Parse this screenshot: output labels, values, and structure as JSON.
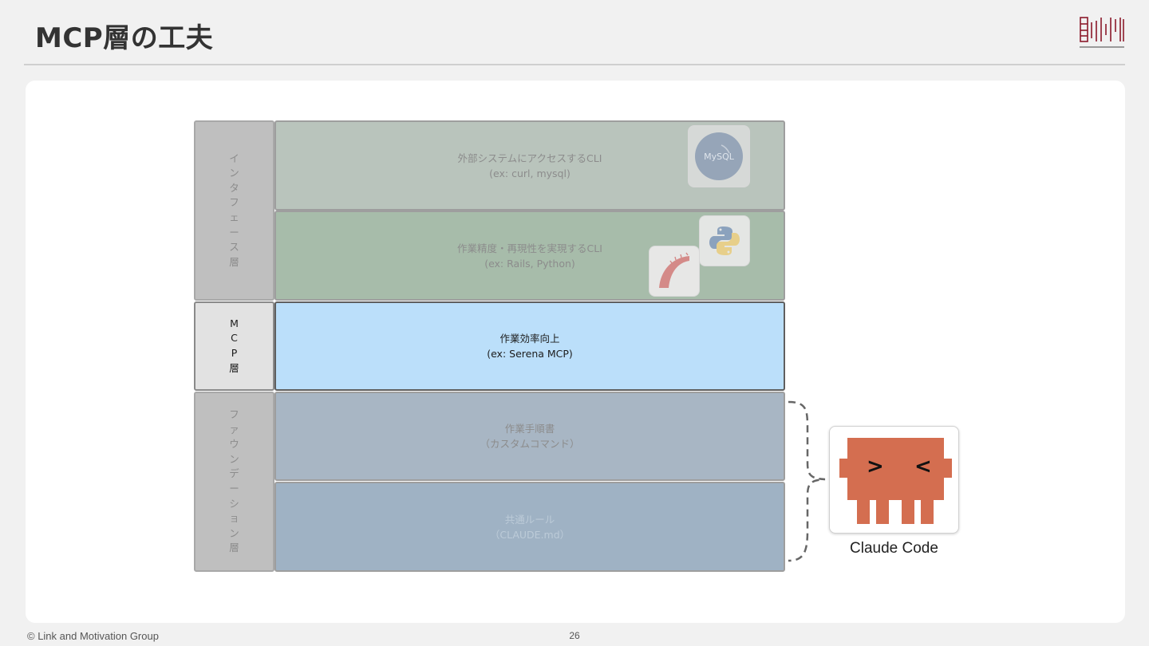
{
  "slide": {
    "title": "MCP層の工夫",
    "footer_copyright": "© Link and Motivation Group",
    "page_number": "26"
  },
  "layers": [
    {
      "side_label": [
        "イ",
        "ン",
        "タ",
        "フ",
        "ェ",
        "ー",
        "ス",
        "層"
      ],
      "rows": [
        {
          "title": "外部システムにアクセスするCLI",
          "example": "(ex: curl, mysql)",
          "color": "#b9c4bc",
          "icons": [
            "mysql-icon"
          ]
        },
        {
          "title": "作業精度・再現性を実現するCLI",
          "example": "(ex: Rails, Python)",
          "color": "#a7bcaa",
          "icons": [
            "python-icon",
            "rails-icon"
          ]
        }
      ]
    },
    {
      "side_label": [
        "M",
        "C",
        "P",
        "層"
      ],
      "active": true,
      "rows": [
        {
          "title": "作業効率向上",
          "example": "(ex: Serena MCP)",
          "color": "#bbdffa"
        }
      ]
    },
    {
      "side_label": [
        "フ",
        "ァ",
        "ウ",
        "ン",
        "デ",
        "ー",
        "シ",
        "ョ",
        "ン",
        "層"
      ],
      "rows": [
        {
          "title": "作業手順書",
          "example": "（カスタムコマンド）",
          "color": "#a8b6c4"
        },
        {
          "title": "共通ルール",
          "example": "（CLAUDE.md）",
          "color": "#9fb2c4"
        }
      ]
    }
  ],
  "icons": {
    "mysql": {
      "label": "MySQL"
    }
  },
  "claude_code": {
    "label": "Claude Code",
    "color": "#d46e50"
  }
}
